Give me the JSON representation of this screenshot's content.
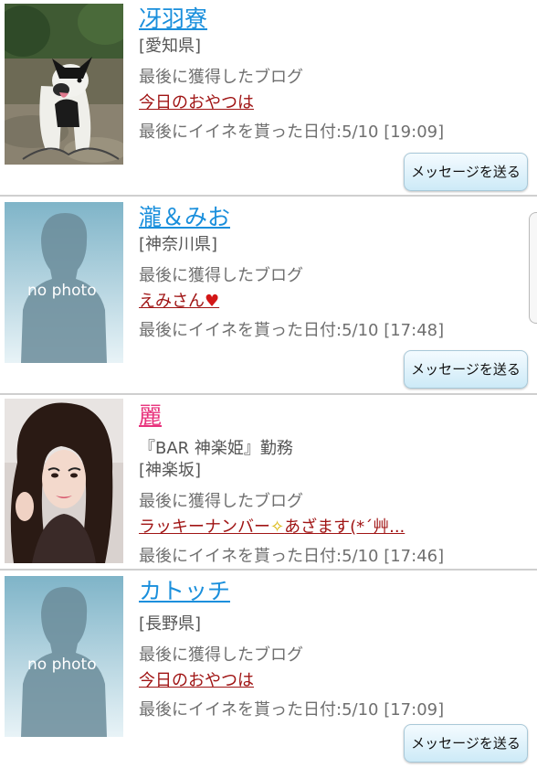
{
  "users": [
    {
      "name": "冴羽寮",
      "subtitle": "",
      "location": "[愛知県]",
      "blog_label": "最後に獲得したブログ",
      "blog_title": "今日のおやつは",
      "liked_text": "最後にイイネを貰った日付:5/10 [19:09]",
      "message_button": "メッセージを送る",
      "photo": "dog-photo"
    },
    {
      "name": "瀧＆みお",
      "subtitle": "",
      "location": "[神奈川県]",
      "blog_label": "最後に獲得したブログ",
      "blog_title": "えみさん",
      "liked_text": "最後にイイネを貰った日付:5/10 [17:48]",
      "message_button": "メッセージを送る",
      "photo_text": "no photo"
    },
    {
      "name": "麗",
      "subtitle": "『BAR 神楽姫』勤務",
      "location": "[神楽坂]",
      "blog_label": "最後に獲得したブログ",
      "blog_title_part1": "ラッキーナンバー",
      "blog_title_part2": "あざます(*´艸...",
      "liked_text": "最後にイイネを貰った日付:5/10 [17:46]",
      "photo": "woman-photo"
    },
    {
      "name": "カトッチ",
      "subtitle": "",
      "location": "[長野県]",
      "blog_label": "最後に獲得したブログ",
      "blog_title": "今日のおやつは",
      "liked_text": "最後にイイネを貰った日付:5/10 [17:09]",
      "message_button": "メッセージを送る",
      "photo_text": "no photo"
    }
  ],
  "icons": {
    "heart": "heart-icon",
    "sparkle": "sparkle-icon"
  },
  "colors": {
    "name_link": "#1a8fdc",
    "name_link_female": "#e8327c",
    "blog_link": "#a01515",
    "button_bg": "#cdeaf7"
  }
}
